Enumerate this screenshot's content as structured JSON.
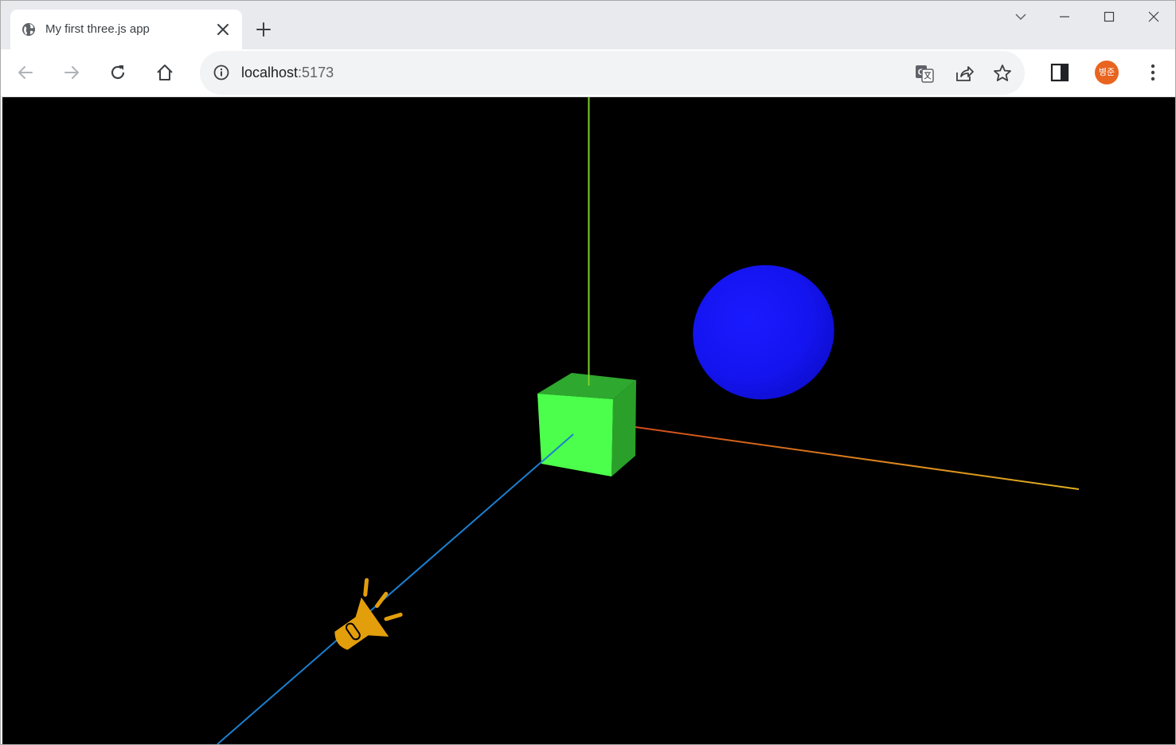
{
  "browser": {
    "tab": {
      "title": "My first three.js app"
    },
    "address_bar": {
      "host": "localhost",
      "port": ":5173"
    },
    "profile": {
      "initials": "병준",
      "color": "#e8641f"
    }
  },
  "scene": {
    "background": "#000000",
    "objects": [
      {
        "name": "cube",
        "color": "#4cff4c"
      },
      {
        "name": "sphere",
        "color": "#1515ff"
      },
      {
        "name": "spotlight-helper",
        "color": "#e39e0c"
      }
    ],
    "axes": {
      "x_color": "#e0a020",
      "y_color": "#7fd02a",
      "z_color": "#1a7fd0"
    }
  }
}
